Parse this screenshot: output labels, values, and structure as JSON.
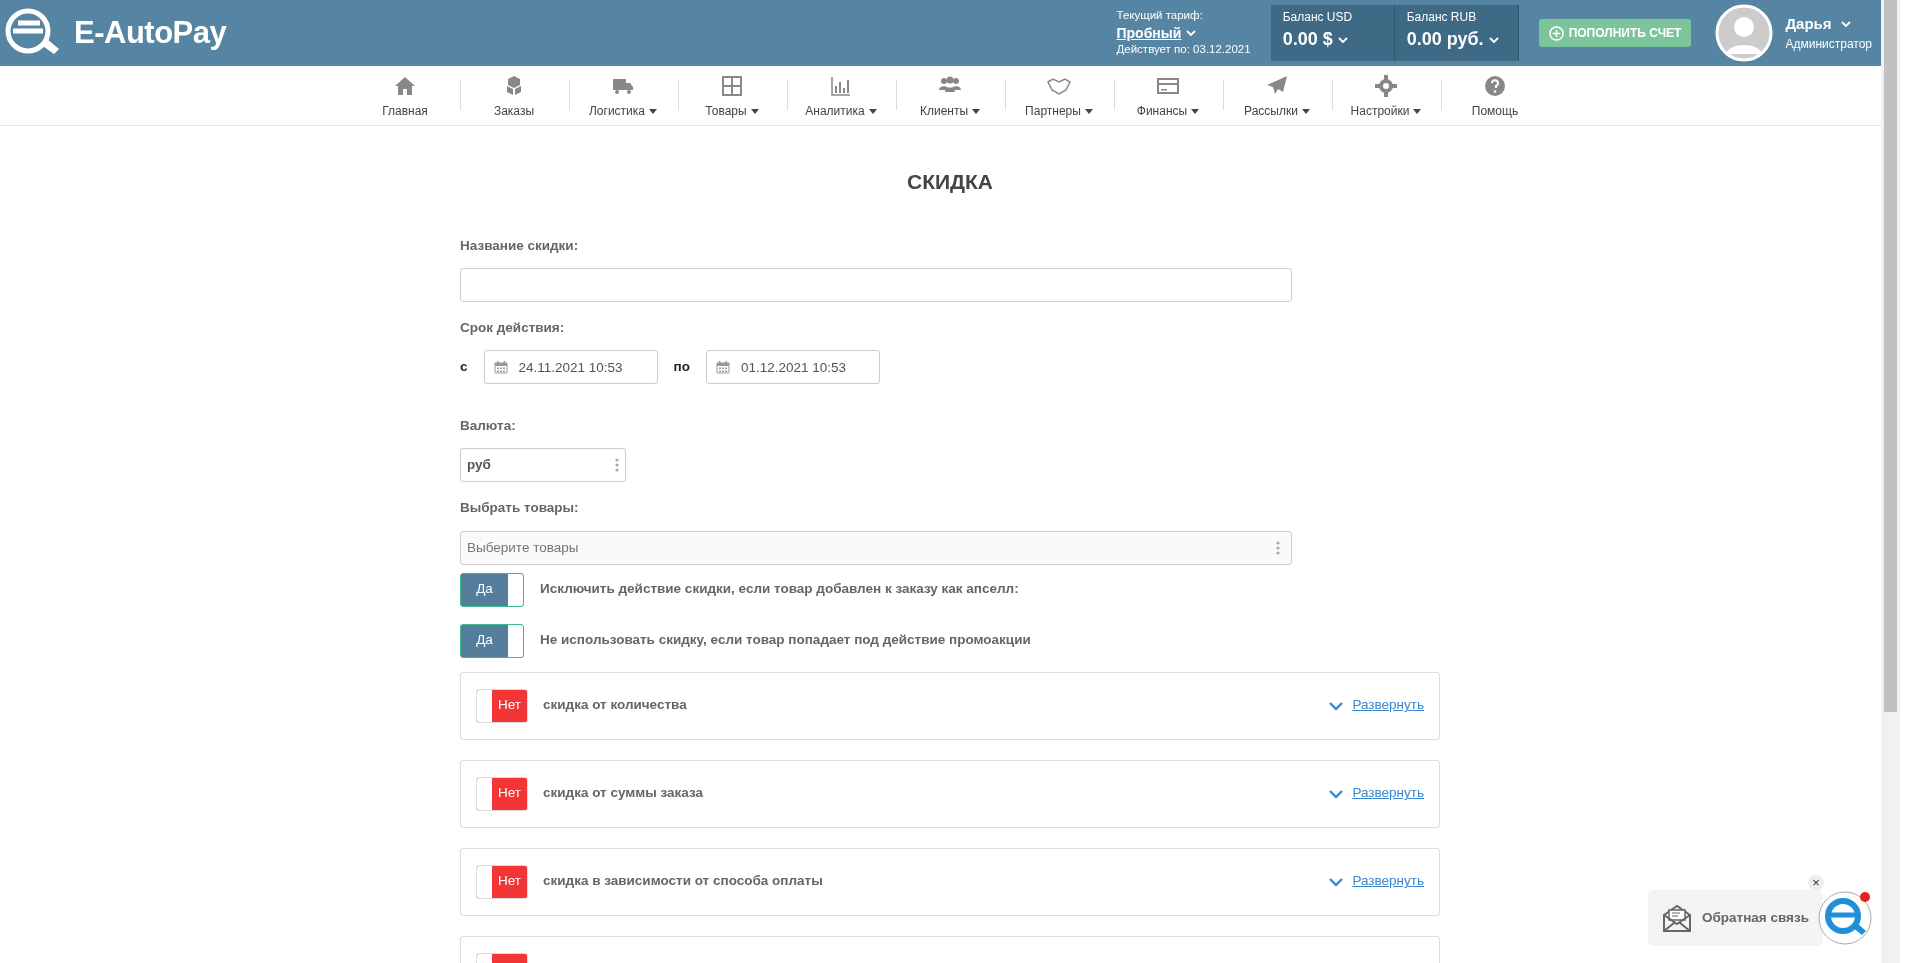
{
  "header": {
    "logo_text": "E-AutoPay",
    "tariff_label": "Текущий тариф:",
    "tariff_name": "Пробный",
    "tariff_valid": "Действует по: 03.12.2021",
    "balances": [
      {
        "label": "Баланс USD",
        "value": "0.00 $"
      },
      {
        "label": "Баланс RUB",
        "value": "0.00 руб."
      }
    ],
    "topup_button": "ПОПОЛНИТЬ СЧЕТ",
    "user": {
      "name": "Дарья",
      "role": "Администратор"
    }
  },
  "nav": [
    {
      "label": "Главная",
      "dropdown": false
    },
    {
      "label": "Заказы",
      "dropdown": false
    },
    {
      "label": "Логистика",
      "dropdown": true
    },
    {
      "label": "Товары",
      "dropdown": true
    },
    {
      "label": "Аналитика",
      "dropdown": true
    },
    {
      "label": "Клиенты",
      "dropdown": true
    },
    {
      "label": "Партнеры",
      "dropdown": true
    },
    {
      "label": "Финансы",
      "dropdown": true
    },
    {
      "label": "Рассылки",
      "dropdown": true
    },
    {
      "label": "Настройки",
      "dropdown": true
    },
    {
      "label": "Помощь",
      "dropdown": false
    }
  ],
  "page_title": "СКИДКА",
  "form": {
    "name_label": "Название скидки:",
    "period_label": "Срок действия:",
    "from_label": "с",
    "from_value": "24.11.2021 10:53",
    "to_label": "по",
    "to_value": "01.12.2021 10:53",
    "currency_label": "Валюта:",
    "currency_value": "руб",
    "products_label": "Выбрать товары:",
    "products_placeholder": "Выберите товары"
  },
  "options": [
    {
      "toggle_text": "Да",
      "on": true,
      "label": "Исключить действие скидки, если товар добавлен к заказу как апселл:"
    },
    {
      "toggle_text": "Да",
      "on": true,
      "label": "Не использовать скидку, если товар попадает под действие промоакции"
    }
  ],
  "sections": [
    {
      "toggle_text": "Нет",
      "on": false,
      "title": "скидка от количества",
      "expand_link": "Развернуть"
    },
    {
      "toggle_text": "Нет",
      "on": false,
      "title": "скидка от суммы заказа",
      "expand_link": "Развернуть"
    },
    {
      "toggle_text": "Нет",
      "on": false,
      "title": "скидка в зависимости от способа оплаты",
      "expand_link": "Развернуть"
    },
    {
      "on": false
    }
  ],
  "feedback": {
    "label": "Обратная связь",
    "close": "×"
  }
}
